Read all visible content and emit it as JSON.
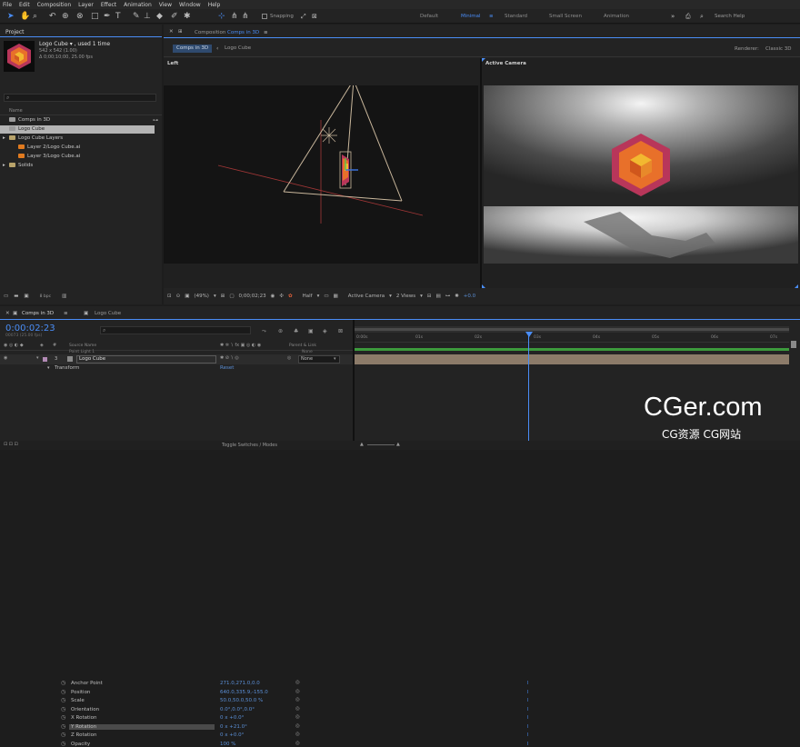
{
  "menu": [
    "File",
    "Edit",
    "Composition",
    "Layer",
    "Effect",
    "Animation",
    "View",
    "Window",
    "Help"
  ],
  "toolbar": {
    "snapping": "Snapping",
    "workspaces": [
      "Default",
      "Minimal",
      "Standard",
      "Small Screen",
      "Animation"
    ],
    "active_workspace": "Minimal",
    "search_placeholder": "Search Help"
  },
  "project": {
    "tab": "Project",
    "item_name": "Logo Cube ▾ , used 1 time",
    "item_dims": "542 x 542 (1.00)",
    "item_duration": "Δ 0;00;10;00, 25.00 fps",
    "column_name": "Name",
    "tree": [
      {
        "label": "Comps in 3D",
        "level": 0,
        "selected": false,
        "type": "comp"
      },
      {
        "label": "Logo Cube",
        "level": 0,
        "selected": true,
        "type": "comp"
      },
      {
        "label": "Logo Cube Layers",
        "level": 0,
        "selected": false,
        "type": "folder"
      },
      {
        "label": "Layer 2/Logo Cube.ai",
        "level": 1,
        "selected": false,
        "type": "ai"
      },
      {
        "label": "Layer 3/Logo Cube.ai",
        "level": 1,
        "selected": false,
        "type": "ai"
      },
      {
        "label": "Solids",
        "level": 0,
        "selected": false,
        "type": "folder"
      }
    ],
    "bpc": "8 bpc"
  },
  "comp_viewer": {
    "title_prefix": "Composition",
    "title": "Comps in 3D",
    "breadcrumbs": [
      "Comps in 3D",
      "Logo Cube"
    ],
    "renderer_label": "Renderer:",
    "renderer": "Classic 3D",
    "left_view_label": "Left",
    "right_view_label": "Active Camera",
    "zoom": "(49%)",
    "timecode": "0;00;02;23",
    "resolution": "Half",
    "camera": "Active Camera",
    "views": "2 Views",
    "exposure": "+0.0"
  },
  "timeline": {
    "tabs": [
      "Comps in 3D",
      "Logo Cube"
    ],
    "current_time": "0:00:02:23",
    "frames_sub": "00073 (25.00 fps)",
    "col_source": "Source Name",
    "col_parent": "Parent & Link",
    "prev_layer": "Point Light 1",
    "prev_parent": "None",
    "layer_num": "3",
    "layer_name": "Logo Cube",
    "layer_parent": "None",
    "transform_label": "Transform",
    "reset_label": "Reset",
    "properties": [
      {
        "name": "Anchor Point",
        "value": "271.0,271.0,0.0"
      },
      {
        "name": "Position",
        "value": "640.0,335.9,-155.0"
      },
      {
        "name": "Scale",
        "value": "50.0,50.0,50.0 %"
      },
      {
        "name": "Orientation",
        "value": "0.0°,0.0°,0.0°"
      },
      {
        "name": "X Rotation",
        "value": "0 x +0.0°"
      },
      {
        "name": "Y Rotation",
        "value": "0 x +21.0°"
      },
      {
        "name": "Z Rotation",
        "value": "0 x +0.0°"
      },
      {
        "name": "Opacity",
        "value": "100 %"
      }
    ],
    "ruler": [
      "0:00s",
      "01s",
      "02s",
      "03s",
      "04s",
      "05s",
      "06s",
      "07s"
    ],
    "toggle_label": "Toggle Switches / Modes"
  },
  "watermark": {
    "main": "CGer.com",
    "sub": "CG资源 CG网站"
  },
  "colors": {
    "accent": "#4a8df6",
    "orange": "#e8702a",
    "magenta": "#b8365a",
    "yellow": "#f2b830"
  }
}
